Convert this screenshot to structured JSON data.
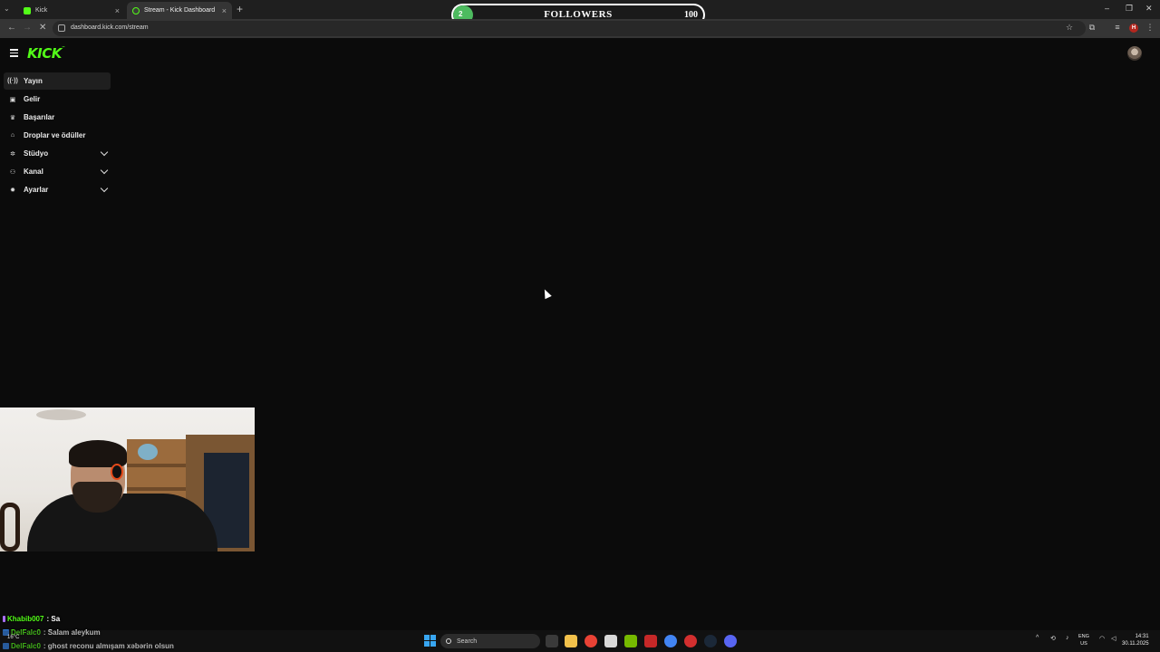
{
  "browser": {
    "tabs": [
      {
        "title": "Kick",
        "active": false
      },
      {
        "title": "Stream - Kick Dashboard",
        "active": true
      }
    ],
    "url": "dashboard.kick.com/stream",
    "profile_initial": "H"
  },
  "overlay": {
    "followers_label": "FOLLOWERS",
    "followers_current": "2",
    "followers_goal": "100",
    "followers_progress": 0.02
  },
  "brand": {
    "logo": "KICK",
    "accent": "#53fc18"
  },
  "sidebar": {
    "items": [
      {
        "label": "Yayın",
        "icon": "broadcast-icon",
        "active": true,
        "expandable": false
      },
      {
        "label": "Gelir",
        "icon": "wallet-icon",
        "active": false,
        "expandable": false
      },
      {
        "label": "Başarılar",
        "icon": "trophy-icon",
        "active": false,
        "expandable": false
      },
      {
        "label": "Droplar ve ödüller",
        "icon": "gift-icon",
        "active": false,
        "expandable": false
      },
      {
        "label": "Stüdyo",
        "icon": "studio-icon",
        "active": false,
        "expandable": true
      },
      {
        "label": "Kanal",
        "icon": "channel-icon",
        "active": false,
        "expandable": true
      },
      {
        "label": "Ayarlar",
        "icon": "gear-icon",
        "active": false,
        "expandable": true
      }
    ]
  },
  "chat": [
    {
      "user": "Khabib007",
      "message": "Sa"
    },
    {
      "user": "DelFalc0",
      "message": "Salam aleykum"
    },
    {
      "user": "DelFalc0",
      "message": "ghost reconu almışam xəbərin olsun"
    }
  ],
  "taskbar": {
    "search_placeholder": "Search",
    "language": "ENG",
    "region": "US",
    "time": "14:31",
    "date": "30.11.2025",
    "weather": "16°C"
  }
}
